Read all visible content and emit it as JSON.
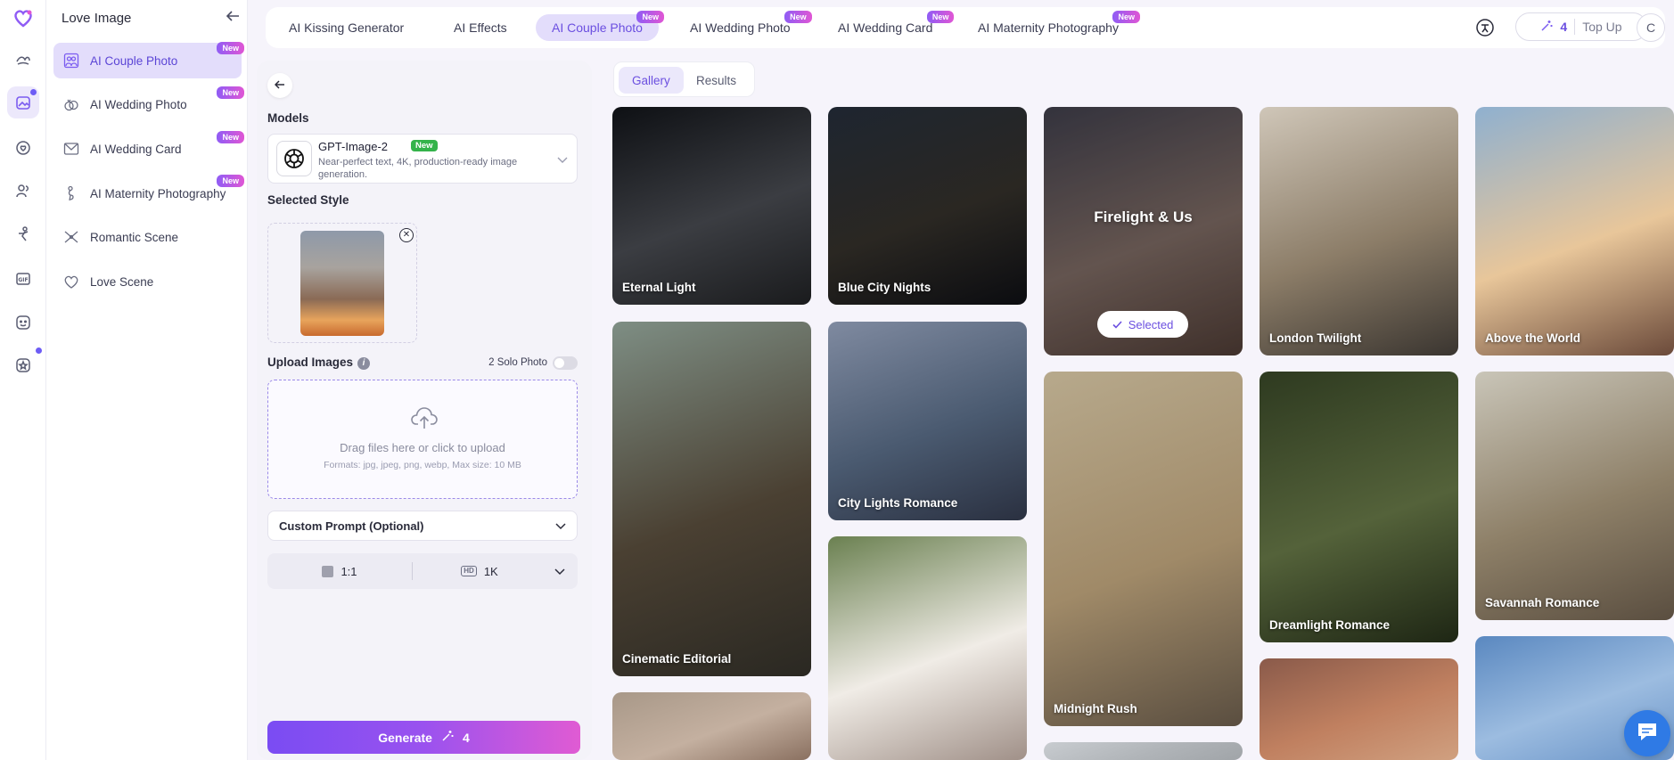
{
  "sidebar": {
    "title": "Love Image",
    "items": [
      {
        "label": "AI Couple Photo",
        "badge": "New",
        "icon": "couple-photo-icon",
        "active": true
      },
      {
        "label": "AI Wedding Photo",
        "badge": "New",
        "icon": "wedding-rings-icon"
      },
      {
        "label": "AI Wedding Card",
        "badge": "New",
        "icon": "wedding-card-icon"
      },
      {
        "label": "AI Maternity Photography",
        "badge": "New",
        "icon": "maternity-icon"
      },
      {
        "label": "Romantic Scene",
        "badge": "",
        "icon": "romantic-scene-icon"
      },
      {
        "label": "Love Scene",
        "badge": "",
        "icon": "love-scene-icon"
      }
    ]
  },
  "topbar": {
    "tabs": [
      {
        "label": "AI Kissing Generator",
        "badge": ""
      },
      {
        "label": "AI Effects",
        "badge": ""
      },
      {
        "label": "AI Couple Photo",
        "badge": "New",
        "active": true
      },
      {
        "label": "AI Wedding Photo",
        "badge": "New"
      },
      {
        "label": "AI Wedding Card",
        "badge": "New"
      },
      {
        "label": "AI Maternity Photography",
        "badge": "New"
      }
    ],
    "credits": "4",
    "topup_label": "Top Up",
    "avatar_initial": "C"
  },
  "panel": {
    "models_label": "Models",
    "model": {
      "name": "GPT-Image-2",
      "badge": "New",
      "description": "Near-perfect text, 4K, production-ready image generation."
    },
    "selected_style_label": "Selected Style",
    "upload_label": "Upload Images",
    "solo_photo_label": "2 Solo Photo",
    "dropzone_main": "Drag files here or click to upload",
    "dropzone_sub": "Formats: jpg, jpeg, png, webp, Max size: 10 MB",
    "custom_prompt_label": "Custom Prompt (Optional)",
    "aspect_ratio": "1:1",
    "resolution": "1K",
    "hd_label": "HD",
    "generate_label": "Generate",
    "generate_cost": "4"
  },
  "gallery": {
    "tabs": [
      {
        "label": "Gallery",
        "active": true
      },
      {
        "label": "Results"
      }
    ],
    "selected_label": "Selected",
    "cards": [
      {
        "title": "Eternal Light",
        "colors": [
          "#0e1014",
          "#3b3d42",
          "#1a1b1d"
        ]
      },
      {
        "title": "Blue City Nights",
        "colors": [
          "#1e2530",
          "#2a2722",
          "#0b0c10"
        ]
      },
      {
        "title": "Firelight & Us",
        "colors": [
          "#3a3d44",
          "#7a6a5c",
          "#4a3a2c"
        ],
        "selected": true
      },
      {
        "title": "London Twilight",
        "colors": [
          "#cfc6b8",
          "#8c7d68",
          "#3a3530"
        ]
      },
      {
        "title": "Above the World",
        "colors": [
          "#8fb0cf",
          "#e8c69a",
          "#6b4a3a"
        ]
      },
      {
        "title": "Cinematic Editorial",
        "colors": [
          "#7e8e84",
          "#4a4032",
          "#2a2822"
        ]
      },
      {
        "title": "City Lights Romance",
        "colors": [
          "#7f8aa0",
          "#4a5a70",
          "#2a3040"
        ]
      },
      {
        "title": "Midnight Rush",
        "colors": [
          "#b7a98c",
          "#a08a68",
          "#5a4e40"
        ]
      },
      {
        "title": "Dreamlight Romance",
        "colors": [
          "#2e3a20",
          "#54623a",
          "#1e2614"
        ]
      },
      {
        "title": "Savannah Romance",
        "colors": [
          "#c9c5b8",
          "#8e8068",
          "#5a4e40"
        ]
      },
      {
        "title": "",
        "colors": [
          "#a89888",
          "#c4b0a0",
          "#8a7060"
        ]
      },
      {
        "title": "",
        "colors": [
          "#6a8050",
          "#f0ece6",
          "#a09088"
        ]
      },
      {
        "title": "",
        "colors": [
          "#c8ccd0",
          "#b0b4b8",
          "#a0a4a8"
        ]
      },
      {
        "title": "",
        "colors": [
          "#8a5a4a",
          "#c08060",
          "#d0a080"
        ]
      },
      {
        "title": "",
        "colors": [
          "#5a88c0",
          "#9cbce0",
          "#6a94c8"
        ]
      }
    ]
  }
}
